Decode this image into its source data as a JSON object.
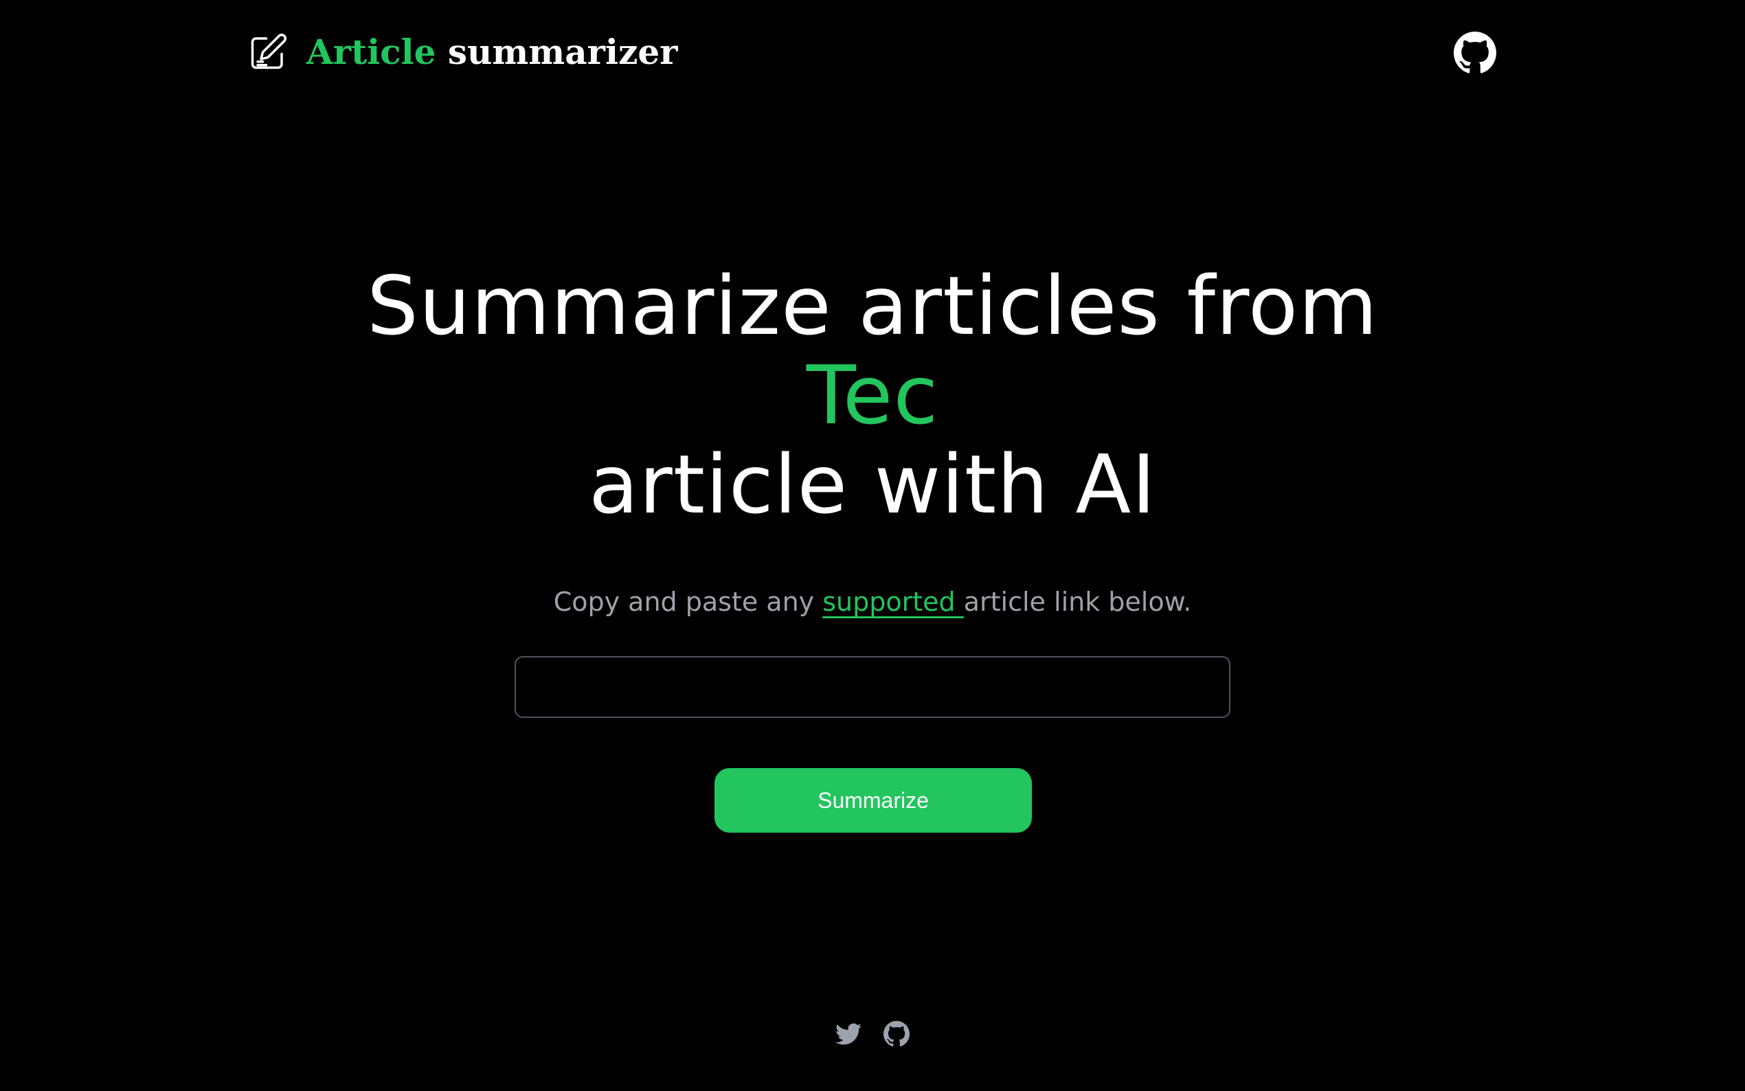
{
  "header": {
    "brand_accent": "Article",
    "brand_rest": " summarizer",
    "brand_icon": "edit-note-icon",
    "github_icon": "github-icon"
  },
  "hero": {
    "line1": "Summarize articles from",
    "line2": "Tec",
    "line3": "article with AI"
  },
  "subtitle": {
    "before": "Copy and paste any ",
    "link": "supported ",
    "after": "article link below."
  },
  "form": {
    "url_value": "",
    "url_placeholder": "",
    "submit_label": "Summarize"
  },
  "footer": {
    "icons": [
      "twitter-icon",
      "github-icon"
    ]
  },
  "colors": {
    "background": "#000000",
    "accent": "#22c55e",
    "text": "#ffffff",
    "muted": "#a1a1aa",
    "footer_icon": "#9ca3af"
  }
}
